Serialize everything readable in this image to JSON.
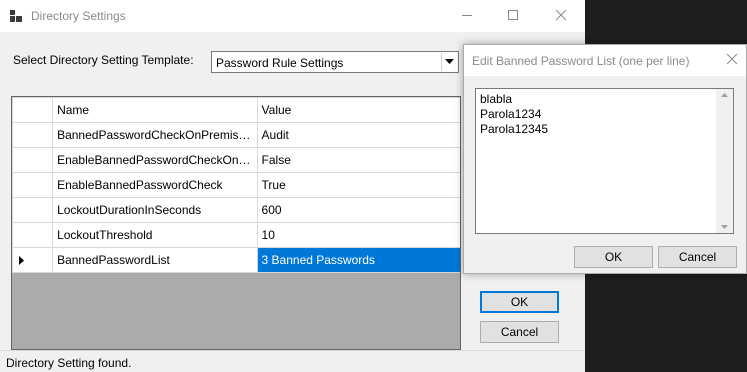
{
  "window": {
    "title": "Directory Settings",
    "template_label": "Select Directory Setting Template:",
    "template_value": "Password Rule Settings",
    "columns": [
      "Name",
      "Value"
    ],
    "rows": [
      {
        "name": "BannedPasswordCheckOnPremisesMode",
        "value": "Audit"
      },
      {
        "name": "EnableBannedPasswordCheckOnPremises",
        "value": "False"
      },
      {
        "name": "EnableBannedPasswordCheck",
        "value": "True"
      },
      {
        "name": "LockoutDurationInSeconds",
        "value": "600"
      },
      {
        "name": "LockoutThreshold",
        "value": "10"
      },
      {
        "name": "BannedPasswordList",
        "value": "3 Banned Passwords"
      }
    ],
    "ok_label": "OK",
    "cancel_label": "Cancel",
    "status": "Directory Setting found."
  },
  "dialog": {
    "title": "Edit Banned Password List (one per line)",
    "lines": [
      "blabla",
      "Parola1234",
      "Parola12345"
    ],
    "ok_label": "OK",
    "cancel_label": "Cancel"
  },
  "colors": {
    "selection": "#0078d7",
    "grid_background": "#ababab",
    "outside_background": "#1e1e1e"
  }
}
